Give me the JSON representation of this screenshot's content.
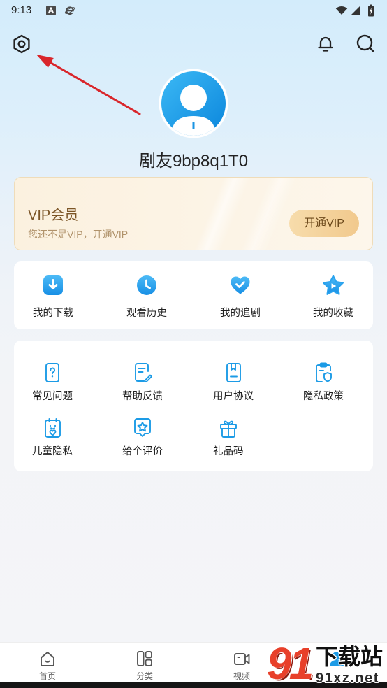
{
  "status_bar": {
    "time": "9:13",
    "icons": [
      "app-a-icon",
      "browser-icon",
      "wifi-icon",
      "signal-icon",
      "battery-charging-icon"
    ]
  },
  "header": {
    "icons": [
      "settings-icon",
      "bell-icon",
      "search-icon"
    ]
  },
  "profile": {
    "username": "剧友9bp8q1T0",
    "avatar_icon": "default-user-avatar-icon"
  },
  "vip": {
    "title": "VIP会员",
    "subtitle": "您还不是VIP，开通VIP",
    "button_label": "开通VIP"
  },
  "quick_actions": [
    {
      "label": "我的下载",
      "icon": "download-icon"
    },
    {
      "label": "观看历史",
      "icon": "history-clock-icon"
    },
    {
      "label": "我的追剧",
      "icon": "heart-check-icon"
    },
    {
      "label": "我的收藏",
      "icon": "star-play-icon"
    }
  ],
  "services": [
    {
      "label": "常见问题",
      "icon": "faq-icon"
    },
    {
      "label": "帮助反馈",
      "icon": "feedback-icon"
    },
    {
      "label": "用户协议",
      "icon": "agreement-icon"
    },
    {
      "label": "隐私政策",
      "icon": "privacy-policy-icon"
    },
    {
      "label": "儿童隐私",
      "icon": "child-privacy-icon"
    },
    {
      "label": "给个评价",
      "icon": "rating-icon"
    },
    {
      "label": "礼品码",
      "icon": "gift-icon"
    }
  ],
  "bottom_nav": [
    {
      "label": "首页",
      "icon": "home-icon"
    },
    {
      "label": "分类",
      "icon": "category-icon"
    },
    {
      "label": "视频",
      "icon": "video-icon"
    },
    {
      "icon": "profile-icon"
    }
  ],
  "watermark": {
    "number": "91",
    "brand": "下载站",
    "domain": "91xz.net"
  },
  "colors": {
    "accent": "#1c9be6",
    "vip_text": "#7b5526",
    "vip_button": "#f1c98d",
    "annotation_arrow": "#d9262b",
    "background_top": "#d3ecfb"
  }
}
